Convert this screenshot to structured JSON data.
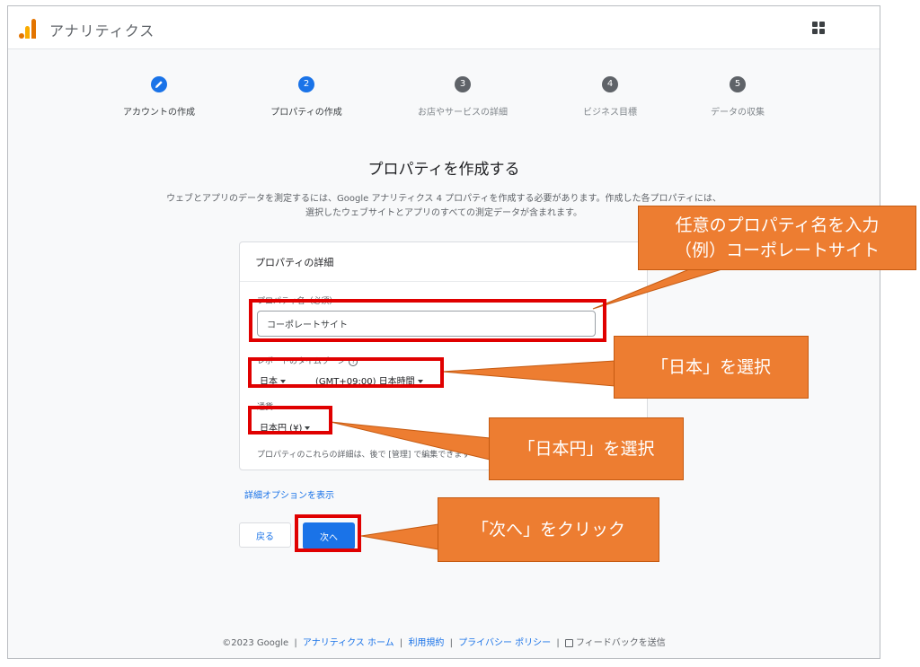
{
  "header": {
    "app_name": "アナリティクス",
    "logo": "analytics-logo-icon",
    "apps_icon": "apps-grid-icon"
  },
  "steps": [
    {
      "num": "",
      "label": "アカウントの作成",
      "state": "done",
      "icon": "pencil-icon"
    },
    {
      "num": "2",
      "label": "プロパティの作成",
      "state": "active"
    },
    {
      "num": "3",
      "label": "お店やサービスの詳細",
      "state": "todo"
    },
    {
      "num": "4",
      "label": "ビジネス目標",
      "state": "todo"
    },
    {
      "num": "5",
      "label": "データの収集",
      "state": "todo"
    }
  ],
  "main": {
    "title": "プロパティを作成する",
    "description": "ウェブとアプリのデータを測定するには、Google アナリティクス 4 プロパティを作成する必要があります。作成した各プロパティには、選択したウェブサイトとアプリのすべての測定データが含まれます。"
  },
  "card": {
    "heading": "プロパティの詳細",
    "name_label": "プロパティ名（必須）",
    "name_value": "コーポレートサイト",
    "timezone_label": "レポートのタイムゾーン",
    "timezone_country": "日本",
    "timezone_value": "(GMT+09:00) 日本時間",
    "currency_label": "通貨",
    "currency_value": "日本円 (¥)",
    "note": "プロパティのこれらの詳細は、後で [管理] で編集できます"
  },
  "actions": {
    "advanced_link": "詳細オプションを表示",
    "back_label": "戻る",
    "next_label": "次へ"
  },
  "footer": {
    "copyright": "©2023 Google",
    "home_link": "アナリティクス ホーム",
    "terms_link": "利用規約",
    "privacy_link": "プライバシー ポリシー",
    "feedback": "フィードバックを送信",
    "separator": "|"
  },
  "annotations": {
    "name_callout_line1": "任意のプロパティ名を入力",
    "name_callout_line2": "（例）コーポレートサイト",
    "timezone_callout": "「日本」を選択",
    "currency_callout": "「日本円」を選択",
    "next_callout": "「次へ」をクリック",
    "callout_color": "#ed7d31",
    "highlight_color": "#e00000"
  }
}
